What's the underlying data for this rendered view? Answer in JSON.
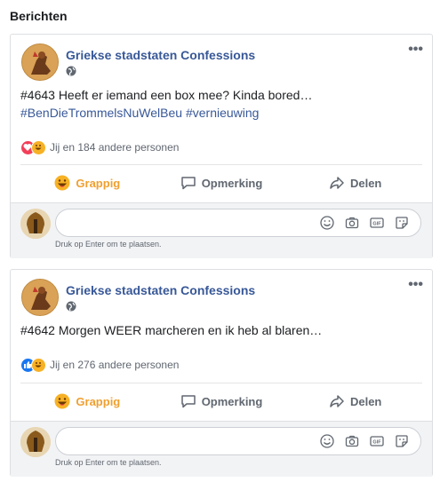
{
  "section_title": "Berichten",
  "posts": [
    {
      "page_name": "Griekse stadstaten Confessions",
      "text": "#4643 Heeft er iemand een box mee? Kinda bored…",
      "hashtags": "#BenDieTrommelsNuWelBeu #vernieuwing",
      "reaction_text": "Jij en 184 andere personen",
      "reaction_types": [
        "love",
        "haha"
      ],
      "actions": {
        "react": "Grappig",
        "comment": "Opmerking",
        "share": "Delen"
      },
      "comment_hint": "Druk op Enter om te plaatsen."
    },
    {
      "page_name": "Griekse stadstaten Confessions",
      "text": "#4642 Morgen WEER marcheren en ik heb al blaren…",
      "hashtags": "",
      "reaction_text": "Jij en 276 andere personen",
      "reaction_types": [
        "like",
        "haha"
      ],
      "actions": {
        "react": "Grappig",
        "comment": "Opmerking",
        "share": "Delen"
      },
      "comment_hint": "Druk op Enter om te plaatsen."
    }
  ],
  "icons": {
    "more": "more-options-icon",
    "globe": "globe-icon",
    "comment_tools": [
      "emoji-icon",
      "camera-icon",
      "gif-icon",
      "sticker-icon"
    ]
  },
  "colors": {
    "link": "#385898",
    "haha": "#f0a030",
    "love": "#f33e58",
    "like": "#1877f2"
  }
}
